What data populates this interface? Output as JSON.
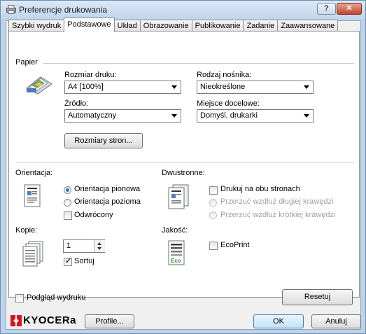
{
  "window": {
    "title": "Preferencje drukowania",
    "help_label": "?",
    "close_label": "✕"
  },
  "tabs": [
    {
      "label": "Szybki wydruk"
    },
    {
      "label": "Podstawowe"
    },
    {
      "label": "Układ"
    },
    {
      "label": "Obrazowanie"
    },
    {
      "label": "Publikowanie"
    },
    {
      "label": "Zadanie"
    },
    {
      "label": "Zaawansowane"
    }
  ],
  "paper": {
    "group_label": "Papier",
    "size_label": "Rozmiar druku:",
    "size_value": "A4  [100%]",
    "media_label": "Rodzaj nośnika:",
    "media_value": "Nieokreślone",
    "source_label": "Źródło:",
    "source_value": "Automatyczny",
    "dest_label": "Miejsce docelowe:",
    "dest_value": "Domyśl. drukarki",
    "page_sizes_button": "Rozmiary stron..."
  },
  "orientation": {
    "label": "Orientacja:",
    "portrait": "Orientacja pionowa",
    "landscape": "Orientacja pozioma",
    "rotated": "Odwrócony",
    "selected": "portrait"
  },
  "duplex": {
    "label": "Dwustronne:",
    "print_both": "Drukuj na obu stronach",
    "flip_long": "Przerzuć wzdłuż długiej krawędzi",
    "flip_short": "Przerzuć wzdłuż krótkiej krawędzi"
  },
  "copies": {
    "label": "Kopie:",
    "value": "1",
    "collate": "Sortuj",
    "collate_checked": true
  },
  "quality": {
    "label": "Jakość:",
    "ecoprint": "EcoPrint",
    "eco_badge": "Eco"
  },
  "preview": {
    "label": "Podgląd wydruku"
  },
  "reset_button": "Resetuj",
  "footer": {
    "brand": "KYOCERa",
    "profile_button": "Profile...",
    "ok_button": "OK",
    "cancel_button": "Anuluj"
  },
  "colors": {
    "brand_red": "#d7141a",
    "accent_blue": "#2a6fd1"
  }
}
